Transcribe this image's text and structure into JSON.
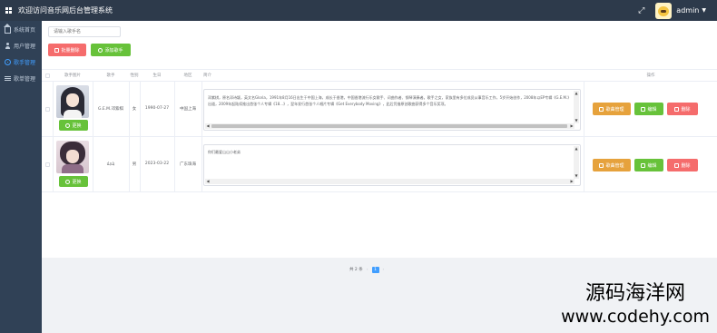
{
  "header": {
    "title": "欢迎访问音乐网后台管理系统",
    "user": "admin"
  },
  "sidebar": {
    "items": [
      {
        "label": "系统首页",
        "icon": "home-icon",
        "active": false
      },
      {
        "label": "用户管理",
        "icon": "user-icon",
        "active": false
      },
      {
        "label": "歌手管理",
        "icon": "singer-icon",
        "active": true
      },
      {
        "label": "歌单管理",
        "icon": "menu-icon",
        "active": false
      }
    ]
  },
  "toolbar": {
    "search_placeholder": "请输入歌手名",
    "batch_delete_label": "批量删除",
    "add_singer_label": "添加歌手"
  },
  "table": {
    "columns": [
      "歌手图片",
      "歌手",
      "性别",
      "生日",
      "地区",
      "简介",
      "操作"
    ],
    "rows": [
      {
        "name": "G.E.M.邓紫棋",
        "gender": "女",
        "birthday": "1990-07-27",
        "region": "中国上海",
        "intro": "邓紫棋，原名邓诗颖，英文名Gloria，1991年8月16日出生于中国上海，成长于香港，中国香港流行乐女歌手、词曲作者、钢琴演奏者。歌手之女，家族里有多位成员从事音乐工作，5岁开始创作，2008年以EP专辑《G.E.M.》出道，2009年起陆续推出首张个人专辑《18...》，翌年发行首张个人唱片专辑《Get Everybody Moving》，此后凭借原创歌曲获得多个音乐奖项。",
        "update_label": "更换"
      },
      {
        "name": "山山",
        "gender": "男",
        "birthday": "2023-03-22",
        "region": "广东珠海",
        "intro": "你们最爱山山小老弟",
        "update_label": "更换"
      }
    ],
    "actions": {
      "song_manage_label": "歌曲管理",
      "edit_label": "编辑",
      "delete_label": "删除"
    }
  },
  "pagination": {
    "total_text": "共 2 条",
    "current_page": "1"
  },
  "watermark": {
    "cn": "源码海洋网",
    "url": "www.codehy.com"
  }
}
